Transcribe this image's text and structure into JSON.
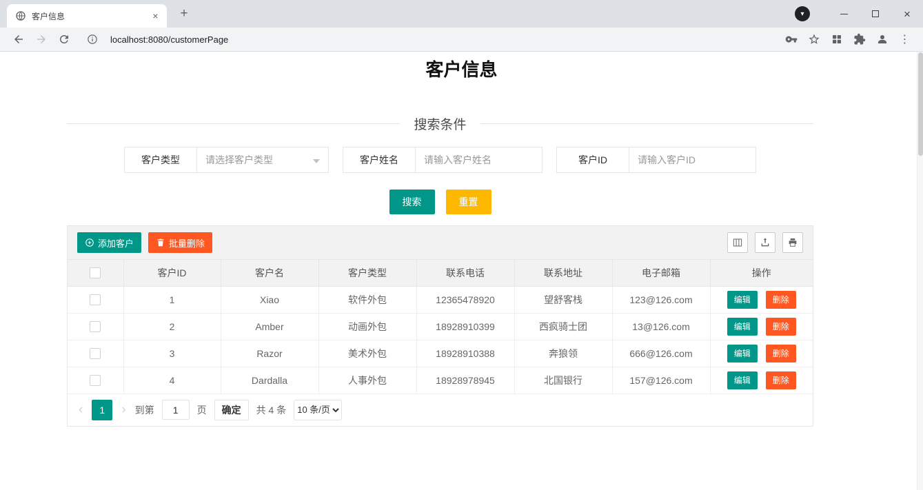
{
  "browser": {
    "tab_title": "客户信息",
    "url": "localhost:8080/customerPage",
    "icons": {
      "tab_close": "×",
      "new_tab": "+",
      "window_close": "×",
      "media_arrow": "▾",
      "menu": "⋮"
    }
  },
  "page": {
    "title": "客户信息",
    "search": {
      "legend": "搜索条件",
      "type_label": "客户类型",
      "type_placeholder": "请选择客户类型",
      "name_label": "客户姓名",
      "name_placeholder": "请输入客户姓名",
      "id_label": "客户ID",
      "id_placeholder": "请输入客户ID",
      "search_button": "搜索",
      "reset_button": "重置"
    },
    "toolbar": {
      "add_button": "添加客户",
      "batch_delete_button": "批量删除"
    },
    "table": {
      "headers": {
        "id": "客户ID",
        "name": "客户名",
        "type": "客户类型",
        "phone": "联系电话",
        "address": "联系地址",
        "email": "电子邮箱",
        "op": "操作"
      },
      "rows": [
        {
          "id": "1",
          "name": "Xiao",
          "type": "软件外包",
          "phone": "12365478920",
          "address": "望舒客栈",
          "email": "123@126.com"
        },
        {
          "id": "2",
          "name": "Amber",
          "type": "动画外包",
          "phone": "18928910399",
          "address": "西疯骑士团",
          "email": "13@126.com"
        },
        {
          "id": "3",
          "name": "Razor",
          "type": "美术外包",
          "phone": "18928910388",
          "address": "奔狼领",
          "email": "666@126.com"
        },
        {
          "id": "4",
          "name": "Dardalla",
          "type": "人事外包",
          "phone": "18928978945",
          "address": "北国银行",
          "email": "157@126.com"
        }
      ],
      "edit_button": "编辑",
      "delete_button": "删除"
    },
    "pagination": {
      "prev": "‹",
      "next": "›",
      "current_page": "1",
      "goto_prefix": "到第",
      "goto_value": "1",
      "goto_suffix": "页",
      "confirm": "确定",
      "total": "共 4 条",
      "page_size": "10 条/页"
    }
  },
  "colors": {
    "primary": "#009688",
    "warning": "#FFB800",
    "danger": "#FF5722"
  }
}
